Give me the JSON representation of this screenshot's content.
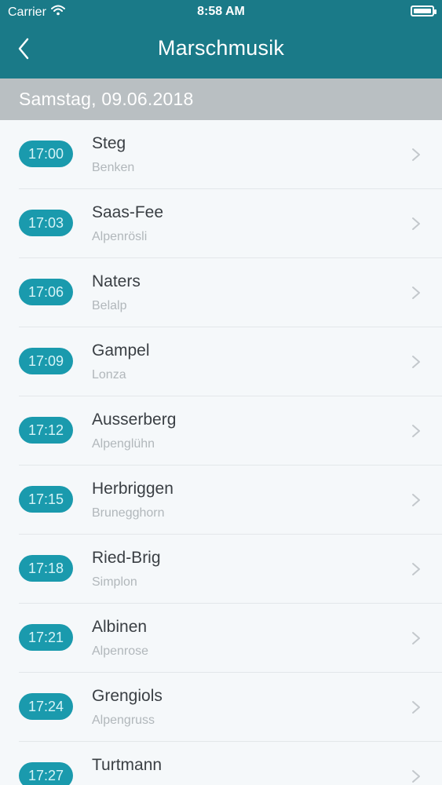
{
  "status": {
    "carrier": "Carrier",
    "time": "8:58 AM"
  },
  "nav": {
    "title": "Marschmusik"
  },
  "date_header": "Samstag, 09.06.2018",
  "items": [
    {
      "time": "17:00",
      "title": "Steg",
      "subtitle": "Benken"
    },
    {
      "time": "17:03",
      "title": "Saas-Fee",
      "subtitle": "Alpenrösli"
    },
    {
      "time": "17:06",
      "title": "Naters",
      "subtitle": "Belalp"
    },
    {
      "time": "17:09",
      "title": "Gampel",
      "subtitle": "Lonza"
    },
    {
      "time": "17:12",
      "title": "Ausserberg",
      "subtitle": "Alpenglühn"
    },
    {
      "time": "17:15",
      "title": "Herbriggen",
      "subtitle": "Brunegghorn"
    },
    {
      "time": "17:18",
      "title": "Ried-Brig",
      "subtitle": "Simplon"
    },
    {
      "time": "17:21",
      "title": "Albinen",
      "subtitle": "Alpenrose"
    },
    {
      "time": "17:24",
      "title": "Grengiols",
      "subtitle": "Alpengruss"
    },
    {
      "time": "17:27",
      "title": "Turtmann",
      "subtitle": ""
    }
  ]
}
